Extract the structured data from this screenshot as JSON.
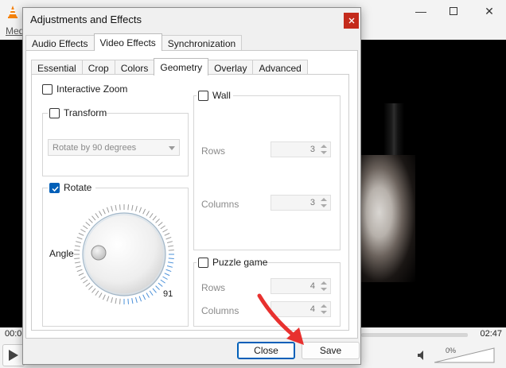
{
  "vlc": {
    "menu_media": "Med",
    "time_elapsed": "00:0",
    "time_total": "02:47",
    "volume_percent": "0%",
    "volume_level": 0,
    "icons": {
      "app": "vlc-cone-icon",
      "play": "play-icon",
      "speaker": "speaker-icon"
    }
  },
  "dialog": {
    "title": "Adjustments and Effects",
    "top_tabs": [
      "Audio Effects",
      "Video Effects",
      "Synchronization"
    ],
    "top_tabs_active": 1,
    "sub_tabs": [
      "Essential",
      "Crop",
      "Colors",
      "Geometry",
      "Overlay",
      "Advanced"
    ],
    "sub_tabs_active": 3,
    "geometry": {
      "interactive_zoom": {
        "label": "Interactive Zoom",
        "checked": false
      },
      "transform": {
        "label": "Transform",
        "checked": false,
        "select_value": "Rotate by 90 degrees"
      },
      "rotate": {
        "label": "Rotate",
        "checked": true,
        "angle_label": "Angle",
        "angle_value": "91"
      },
      "wall": {
        "label": "Wall",
        "checked": false,
        "rows_label": "Rows",
        "rows_value": "3",
        "columns_label": "Columns",
        "columns_value": "3"
      },
      "puzzle": {
        "label": "Puzzle game",
        "checked": false,
        "rows_label": "Rows",
        "rows_value": "4",
        "columns_label": "Columns",
        "columns_value": "4"
      }
    },
    "buttons": {
      "close": "Close",
      "save": "Save"
    }
  },
  "colors": {
    "accent": "#005fb8",
    "close_red": "#c42b1c",
    "annotation_red": "#e8312f"
  }
}
